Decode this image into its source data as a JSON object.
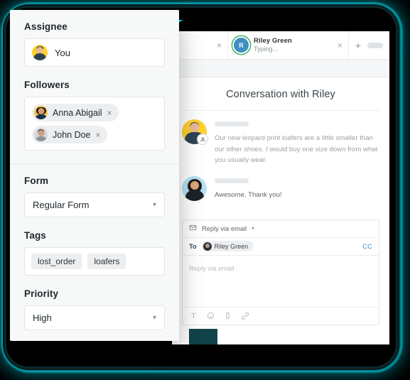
{
  "sidebar": {
    "assignee": {
      "label": "Assignee",
      "name": "You",
      "avatar_icon": "user-avatar-yellow"
    },
    "followers": {
      "label": "Followers",
      "items": [
        {
          "name": "Anna Abigail",
          "remove_label": "×",
          "avatar_icon": "user-avatar-anna"
        },
        {
          "name": "John Doe",
          "remove_label": "×",
          "avatar_icon": "user-avatar-john"
        }
      ]
    },
    "form": {
      "label": "Form",
      "value": "Regular Form",
      "caret_icon": "chevron-down-icon"
    },
    "tags": {
      "label": "Tags",
      "items": [
        "lost_order",
        "loafers"
      ]
    },
    "priority": {
      "label": "Priority",
      "value": "High",
      "caret_icon": "chevron-down-icon"
    }
  },
  "window": {
    "tabs": {
      "ghost_tab_close": "×",
      "active": {
        "avatar_initial": "R",
        "name": "Riley Green",
        "status": "Typing...",
        "close_label": "×",
        "status_ring_color": "#2fae5f"
      },
      "add_tab_label": "+",
      "overflow_pill": "tab-placeholder-pill"
    },
    "conversation": {
      "title": "Conversation with Riley",
      "messages": [
        {
          "author_avatar": "agent-avatar-yellow",
          "name_placeholder": "skeleton-bar",
          "text": "Our new leopard print loafers are a little smaller than our other shoes. I would buy one size down from what you usually wear.",
          "role": "agent"
        },
        {
          "author_avatar": "customer-avatar-blue",
          "name_placeholder": "skeleton-bar",
          "text": "Awesome. Thank you!",
          "role": "customer"
        }
      ]
    },
    "composer": {
      "mode_label": "Reply via email",
      "mode_icon": "envelope-icon",
      "mode_caret": "chevron-down-icon",
      "to_label": "To",
      "recipient": "Riley Green",
      "cc_label": "CC",
      "placeholder": "Reply via email",
      "tools": [
        {
          "icon": "text-format-icon",
          "label": "T"
        },
        {
          "icon": "emoji-icon",
          "label": "☺"
        },
        {
          "icon": "attachment-icon",
          "label": "attach"
        },
        {
          "icon": "link-icon",
          "label": "link"
        }
      ]
    }
  },
  "theme": {
    "glow": "#00e9ff",
    "frame_dark": "#0b2a2e",
    "accent_link": "#3f87d8",
    "online": "#2fae5f"
  }
}
